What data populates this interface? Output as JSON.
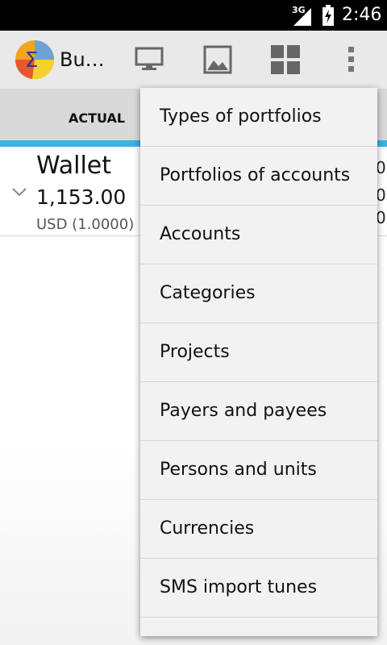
{
  "status_bar": {
    "network": "3G",
    "time": "2:46"
  },
  "action_bar": {
    "title": "Bu…",
    "icons": [
      "monitor-icon",
      "image-icon",
      "grid-icon",
      "overflow-icon"
    ]
  },
  "tabs": [
    {
      "label": "ACTUAL"
    }
  ],
  "wallet": {
    "name": "Wallet",
    "amount": "1,153.00",
    "currency": "USD (1.0000)",
    "edge_digits": [
      "0",
      "0",
      "0"
    ]
  },
  "menu": {
    "items": [
      {
        "label": "Types of portfolios"
      },
      {
        "label": "Portfolios of accounts"
      },
      {
        "label": "Accounts"
      },
      {
        "label": "Categories"
      },
      {
        "label": "Projects"
      },
      {
        "label": "Payers and payees"
      },
      {
        "label": "Persons and units"
      },
      {
        "label": "Currencies"
      },
      {
        "label": "SMS import tunes"
      }
    ]
  },
  "colors": {
    "tab_indicator": "#33b5e5",
    "action_bar_bg": "#e9e9e9",
    "menu_bg": "#f2f2f2"
  }
}
